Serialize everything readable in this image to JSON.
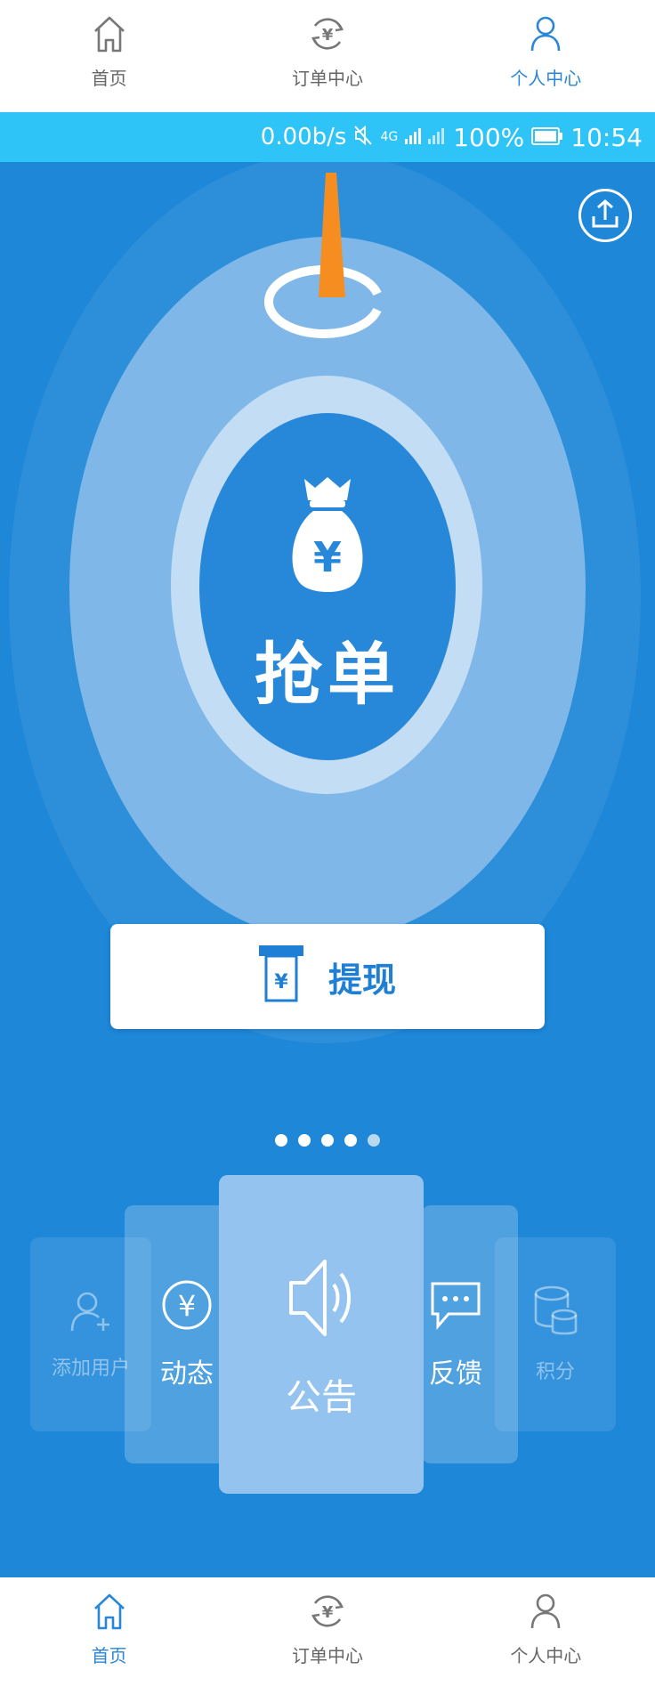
{
  "top_tabs": [
    {
      "label": "首页",
      "icon": "home-icon",
      "active": false
    },
    {
      "label": "订单中心",
      "icon": "yuan-cycle-icon",
      "active": false
    },
    {
      "label": "个人中心",
      "icon": "user-icon",
      "active": true
    }
  ],
  "status_bar": {
    "net_speed": "0.00b/s",
    "mute_icon": "mute-icon",
    "signal": "4G",
    "battery": "100%",
    "time": "10:54"
  },
  "main": {
    "grab_label": "抢单",
    "withdraw_label": "提现",
    "carousel": {
      "items": [
        {
          "label": "添加用户",
          "icon": "add-user-icon"
        },
        {
          "label": "动态",
          "icon": "yuan-circle-icon"
        },
        {
          "label": "公告",
          "icon": "speaker-icon"
        },
        {
          "label": "反馈",
          "icon": "chat-icon"
        },
        {
          "label": "积分",
          "icon": "coins-icon"
        }
      ],
      "dots_total": 5,
      "dot_active": 5
    }
  },
  "bottom_tabs": [
    {
      "label": "首页",
      "icon": "home-icon",
      "active": true
    },
    {
      "label": "订单中心",
      "icon": "yuan-cycle-icon",
      "active": false
    },
    {
      "label": "个人中心",
      "icon": "user-icon",
      "active": false
    }
  ],
  "colors": {
    "accent": "#2a86d6",
    "status_bar": "#2ec4f7",
    "main_bg": "#1e87d8",
    "pointer": "#f58d20"
  }
}
